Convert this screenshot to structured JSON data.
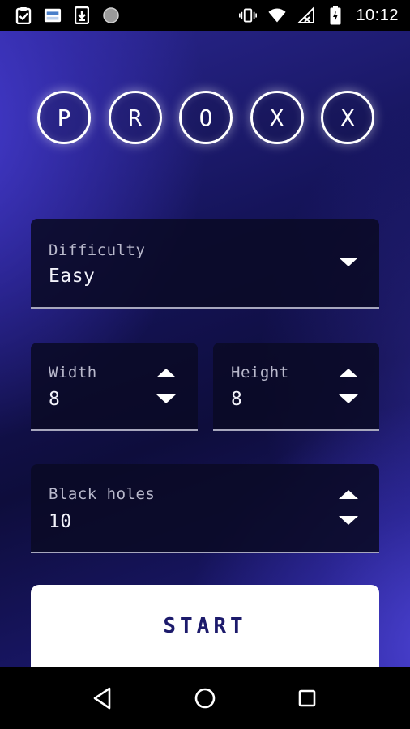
{
  "status_bar": {
    "time": "10:12",
    "left_icons": [
      "clipboard-check-icon",
      "sim-card-icon",
      "download-box-icon",
      "circle-icon"
    ],
    "right_icons": [
      "vibrate-icon",
      "wifi-icon",
      "no-signal-icon",
      "battery-charging-icon"
    ]
  },
  "logo": {
    "letters": [
      "P",
      "R",
      "O",
      "X",
      "X"
    ]
  },
  "form": {
    "difficulty": {
      "label": "Difficulty",
      "value": "Easy"
    },
    "width": {
      "label": "Width",
      "value": "8"
    },
    "height": {
      "label": "Height",
      "value": "8"
    },
    "black_holes": {
      "label": "Black holes",
      "value": "10"
    }
  },
  "start_button": {
    "label": "START"
  },
  "nav_bar": {
    "buttons": [
      "back-icon",
      "home-icon",
      "recents-icon"
    ]
  },
  "colors": {
    "accent": "#2a2690",
    "field_bg": "#0a0a26",
    "button_text": "#1c1a6b"
  }
}
